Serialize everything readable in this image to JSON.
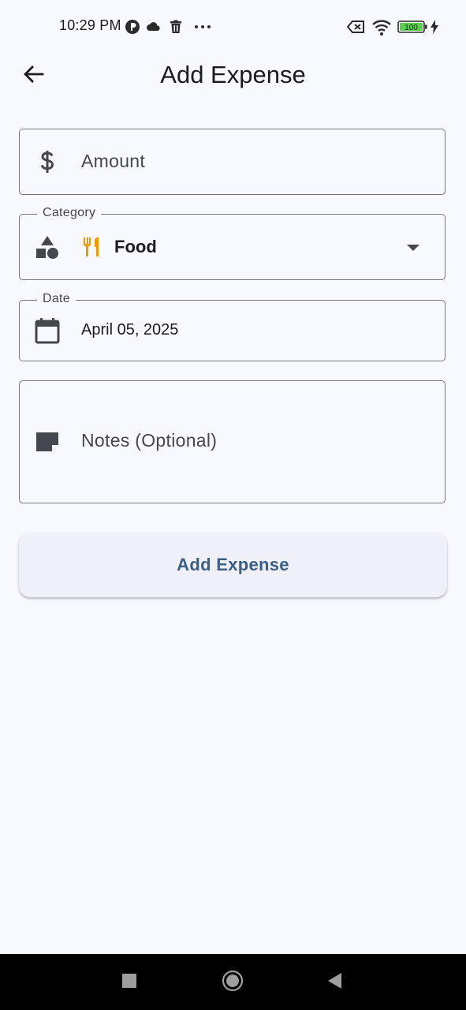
{
  "status_bar": {
    "time": "10:29 PM",
    "icons": [
      "p-badge-icon",
      "cloud-icon",
      "trash-icon",
      "more-dots-icon",
      "sim-off-icon",
      "wifi-icon",
      "battery-icon",
      "charging-bolt-icon"
    ],
    "battery_level": "100"
  },
  "app_bar": {
    "back_icon": "arrow-back-icon",
    "title": "Add Expense"
  },
  "form": {
    "amount": {
      "placeholder": "Amount",
      "icon": "dollar-icon"
    },
    "category": {
      "label": "Category",
      "value": "Food",
      "value_icon": "fork-knife-icon",
      "value_icon_color": "#f29900",
      "icon": "shapes-icon"
    },
    "date": {
      "label": "Date",
      "value": "April 05, 2025",
      "icon": "calendar-icon"
    },
    "notes": {
      "placeholder": "Notes (Optional)",
      "icon": "note-icon"
    },
    "submit_label": "Add Expense"
  },
  "nav_bar": {
    "buttons": [
      "recents-square-icon",
      "home-circle-icon",
      "back-triangle-icon"
    ]
  },
  "colors": {
    "background": "#f7f9ff",
    "outline": "#74777f",
    "primary": "#3a5f86",
    "button_bg": "#eff0f8"
  }
}
